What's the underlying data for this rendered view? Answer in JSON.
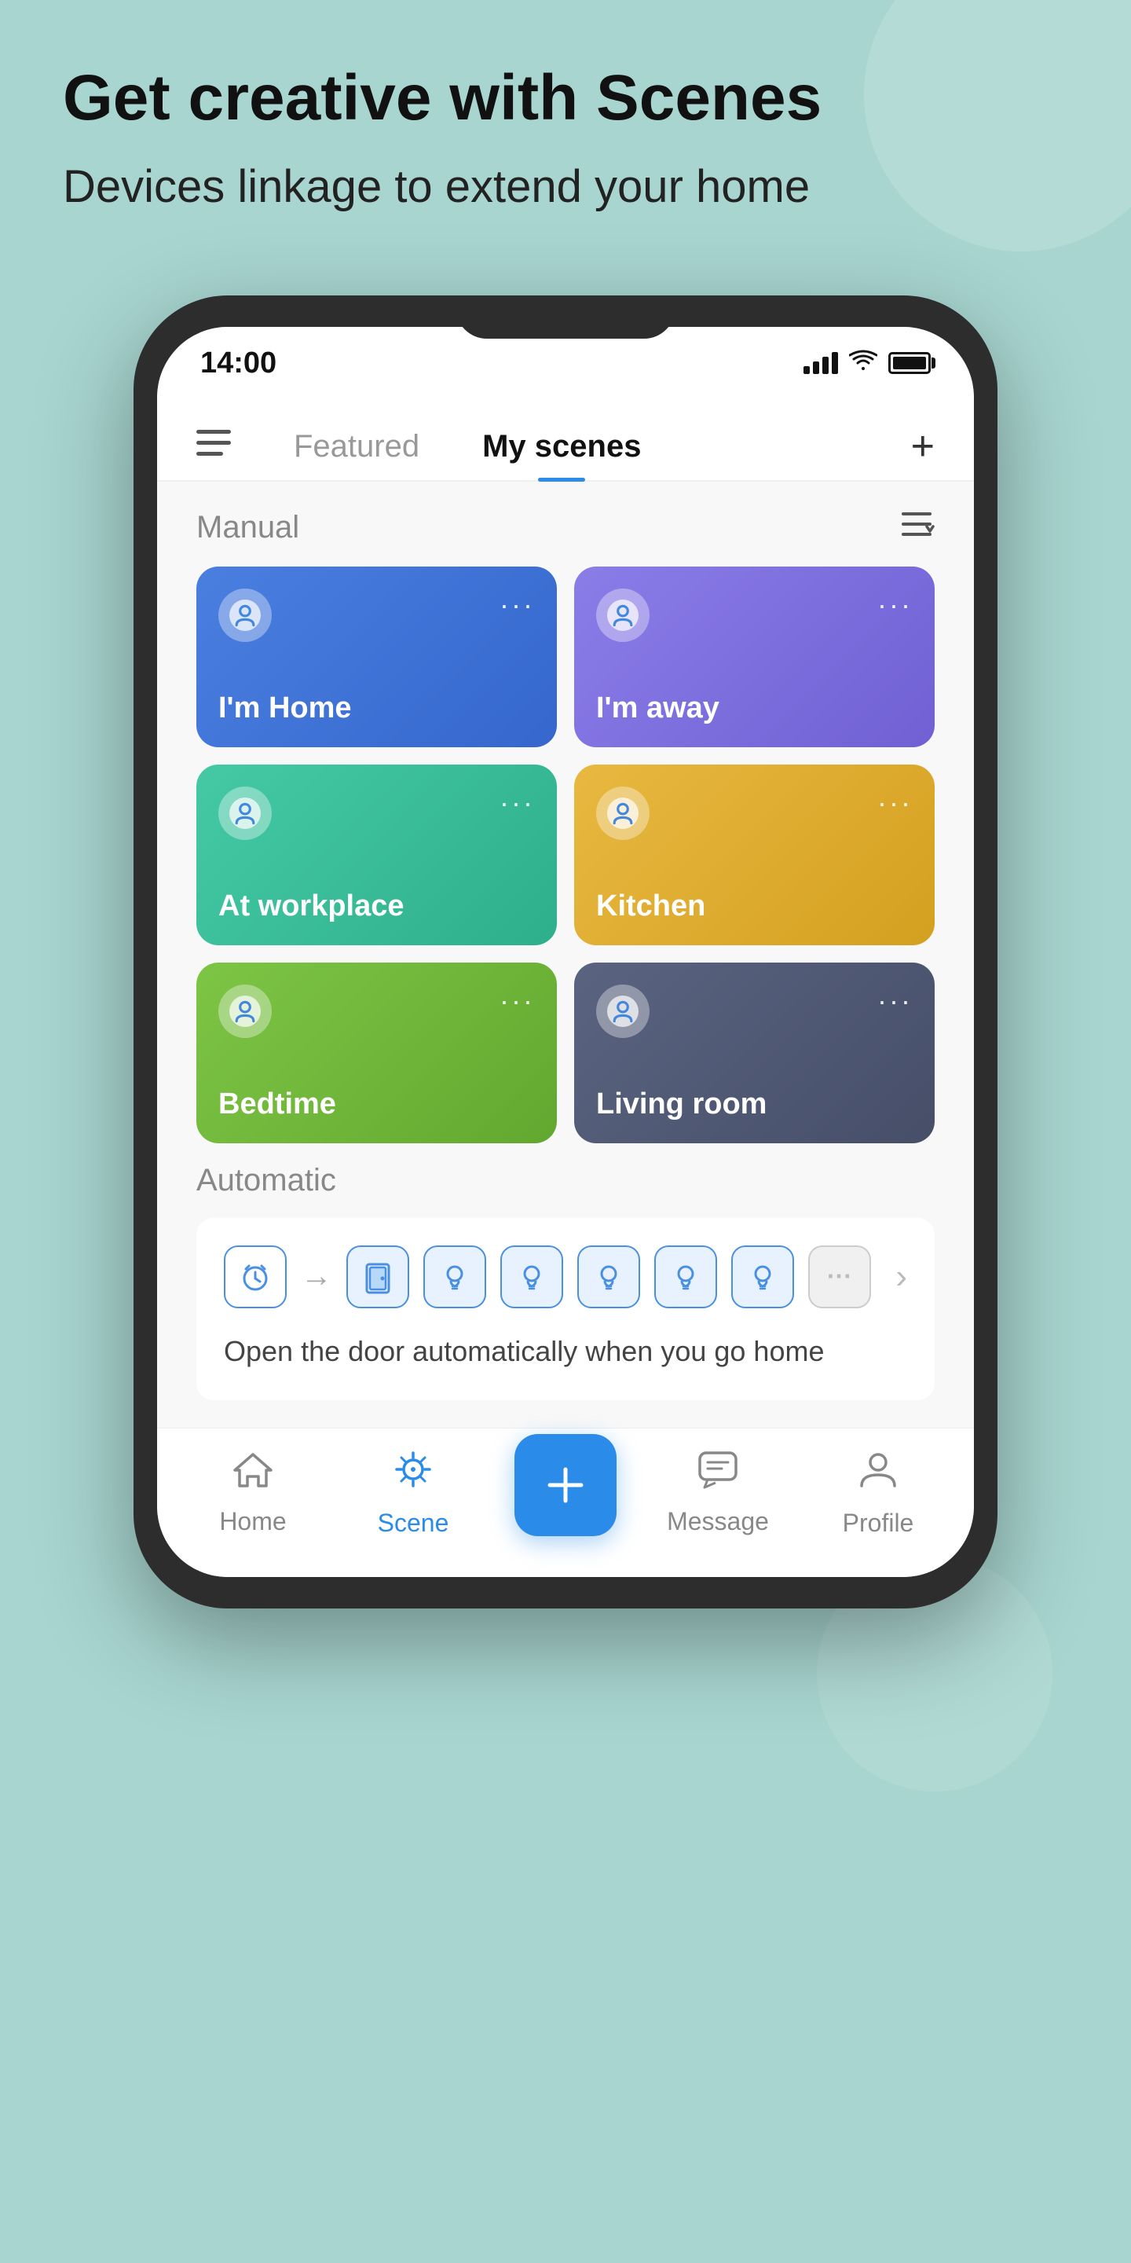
{
  "header": {
    "title": "Get creative with Scenes",
    "subtitle": "Devices linkage to extend your home"
  },
  "status_bar": {
    "time": "14:00"
  },
  "navigation": {
    "featured_tab": "Featured",
    "my_scenes_tab": "My scenes",
    "add_button": "+"
  },
  "manual_section": {
    "title": "Manual",
    "scenes": [
      {
        "name": "I'm Home",
        "color_class": "card-blue"
      },
      {
        "name": "I'm away",
        "color_class": "card-purple"
      },
      {
        "name": "At workplace",
        "color_class": "card-teal"
      },
      {
        "name": "Kitchen",
        "color_class": "card-orange"
      },
      {
        "name": "Bedtime",
        "color_class": "card-green"
      },
      {
        "name": "Living room",
        "color_class": "card-dark"
      }
    ],
    "more_label": "···"
  },
  "automatic_section": {
    "title": "Automatic",
    "card": {
      "description": "Open the door automatically when you go home"
    }
  },
  "bottom_nav": {
    "items": [
      {
        "label": "Home",
        "icon": "🏠",
        "active": false
      },
      {
        "label": "Scene",
        "icon": "⊙",
        "active": true
      },
      {
        "label": "",
        "icon": "+",
        "active": false,
        "is_center": true
      },
      {
        "label": "Message",
        "icon": "💬",
        "active": false
      },
      {
        "label": "Profile",
        "icon": "👤",
        "active": false
      }
    ]
  }
}
